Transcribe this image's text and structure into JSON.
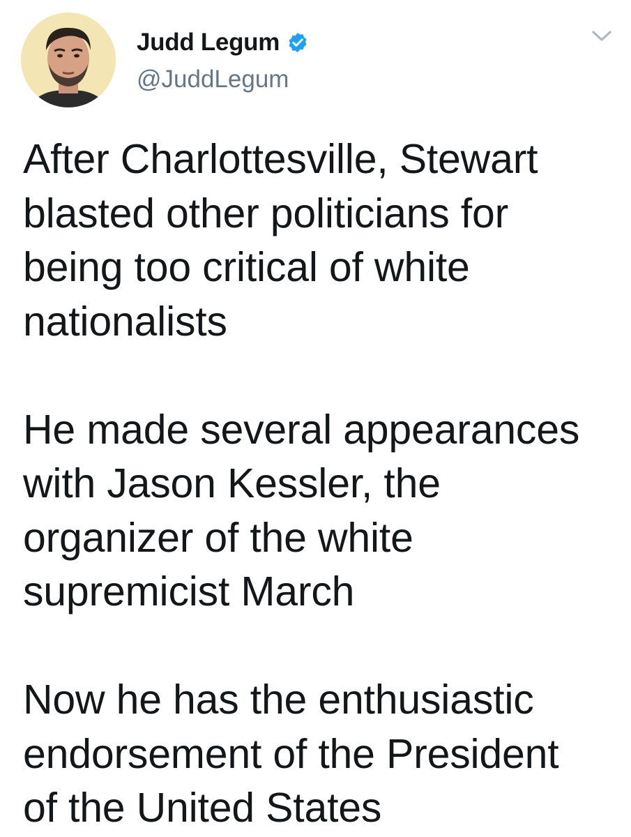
{
  "tweet": {
    "author": {
      "display_name": "Judd Legum",
      "handle": "@JuddLegum",
      "verified": true,
      "verified_icon": "verified-badge-icon",
      "avatar_icon": "profile-avatar"
    },
    "menu_icon": "chevron-down-icon",
    "paragraphs": [
      {
        "lines": [
          "After Charlottesville, Stewart",
          "blasted other politicians for",
          "being too critical of white",
          "nationalists"
        ]
      },
      {
        "lines": [
          "He made several appearances",
          "with Jason Kessler, the",
          "organizer of the white",
          "supremicist March"
        ]
      },
      {
        "lines": [
          "Now he has the enthusiastic",
          "endorsement of the President",
          "of the United States"
        ]
      }
    ]
  },
  "colors": {
    "text": "#14171a",
    "secondary_text": "#657786",
    "verified_blue": "#1da1f2",
    "caret_gray": "#aab8c2",
    "avatar_bg": "#f3e6b4"
  }
}
